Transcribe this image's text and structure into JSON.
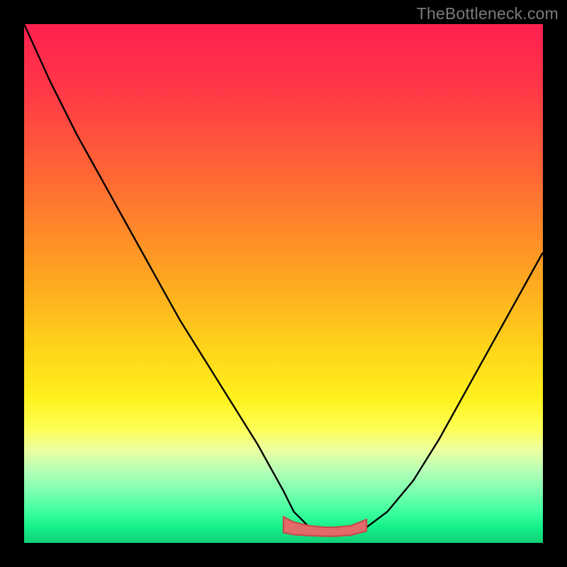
{
  "watermark": "TheBottleneck.com",
  "colors": {
    "frame": "#000000",
    "curve": "#000000",
    "zone_fill": "#e26b69",
    "zone_stroke": "#c74a4a",
    "gradient_stops": [
      "#ff1f4f",
      "#ff3b46",
      "#ff6a33",
      "#ffa321",
      "#ffd21a",
      "#fff11c",
      "#fdff55",
      "#edffa0",
      "#b6ffb6",
      "#7dffb0",
      "#3dffa0",
      "#15f08a",
      "#10d076"
    ]
  },
  "chart_data": {
    "type": "line",
    "title": "",
    "xlabel": "",
    "ylabel": "",
    "xlim": [
      0,
      100
    ],
    "ylim": [
      0,
      100
    ],
    "series": [
      {
        "name": "curve",
        "x": [
          0,
          5,
          10,
          15,
          20,
          25,
          30,
          35,
          40,
          45,
          50,
          52,
          55,
          58,
          60,
          63,
          66,
          70,
          75,
          80,
          85,
          90,
          95,
          100
        ],
        "y": [
          100,
          89,
          79,
          70,
          61,
          52,
          43,
          35,
          27,
          19,
          10,
          6,
          3,
          2,
          2,
          2,
          3,
          6,
          12,
          20,
          29,
          38,
          47,
          56
        ]
      }
    ],
    "optimal_zone": {
      "x": [
        50,
        52,
        55,
        58,
        60,
        63,
        66
      ],
      "y_top": [
        5,
        4,
        3.3,
        3,
        3,
        3.3,
        4.5
      ],
      "y_bot": [
        2,
        1.6,
        1.4,
        1.3,
        1.3,
        1.5,
        2.3
      ]
    }
  }
}
